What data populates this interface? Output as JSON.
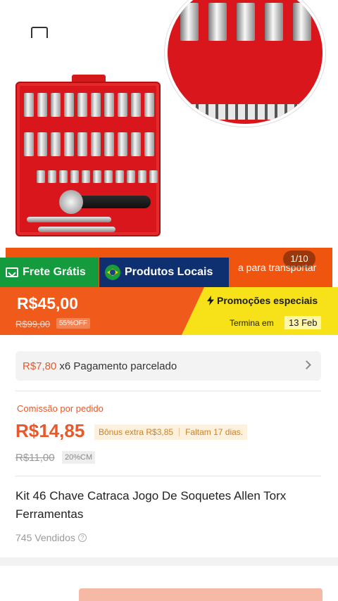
{
  "gallery": {
    "counter": "1/10",
    "banner_text": "a para transportar"
  },
  "tags": {
    "shipping": "Frete Grátis",
    "local": "Produtos Locais"
  },
  "price": {
    "current": "R$45,00",
    "original": "R$99,00",
    "discount": "55%OFF"
  },
  "promo": {
    "title": "Promoções especiais",
    "ends_label": "Termina em",
    "ends_date": "13 Feb"
  },
  "installment": {
    "amount": "R$7,80",
    "text": "x6 Pagamento parcelado"
  },
  "commission": {
    "label": "Comissão por pedido",
    "value": "R$14,85",
    "bonus": "Bônus extra R$3,85",
    "remaining": "Faltam 17 dias.",
    "original": "R$11,00",
    "badge": "20%CM"
  },
  "product": {
    "title": "Kit 46 Chave Catraca Jogo De Soquetes Allen Torx Ferramentas",
    "sold": "745 Vendidos"
  },
  "colors": {
    "accent": "#f05a1a",
    "promo": "#f7e21a",
    "shipping_tag": "#139b3d",
    "local_tag": "#0e2f70"
  }
}
